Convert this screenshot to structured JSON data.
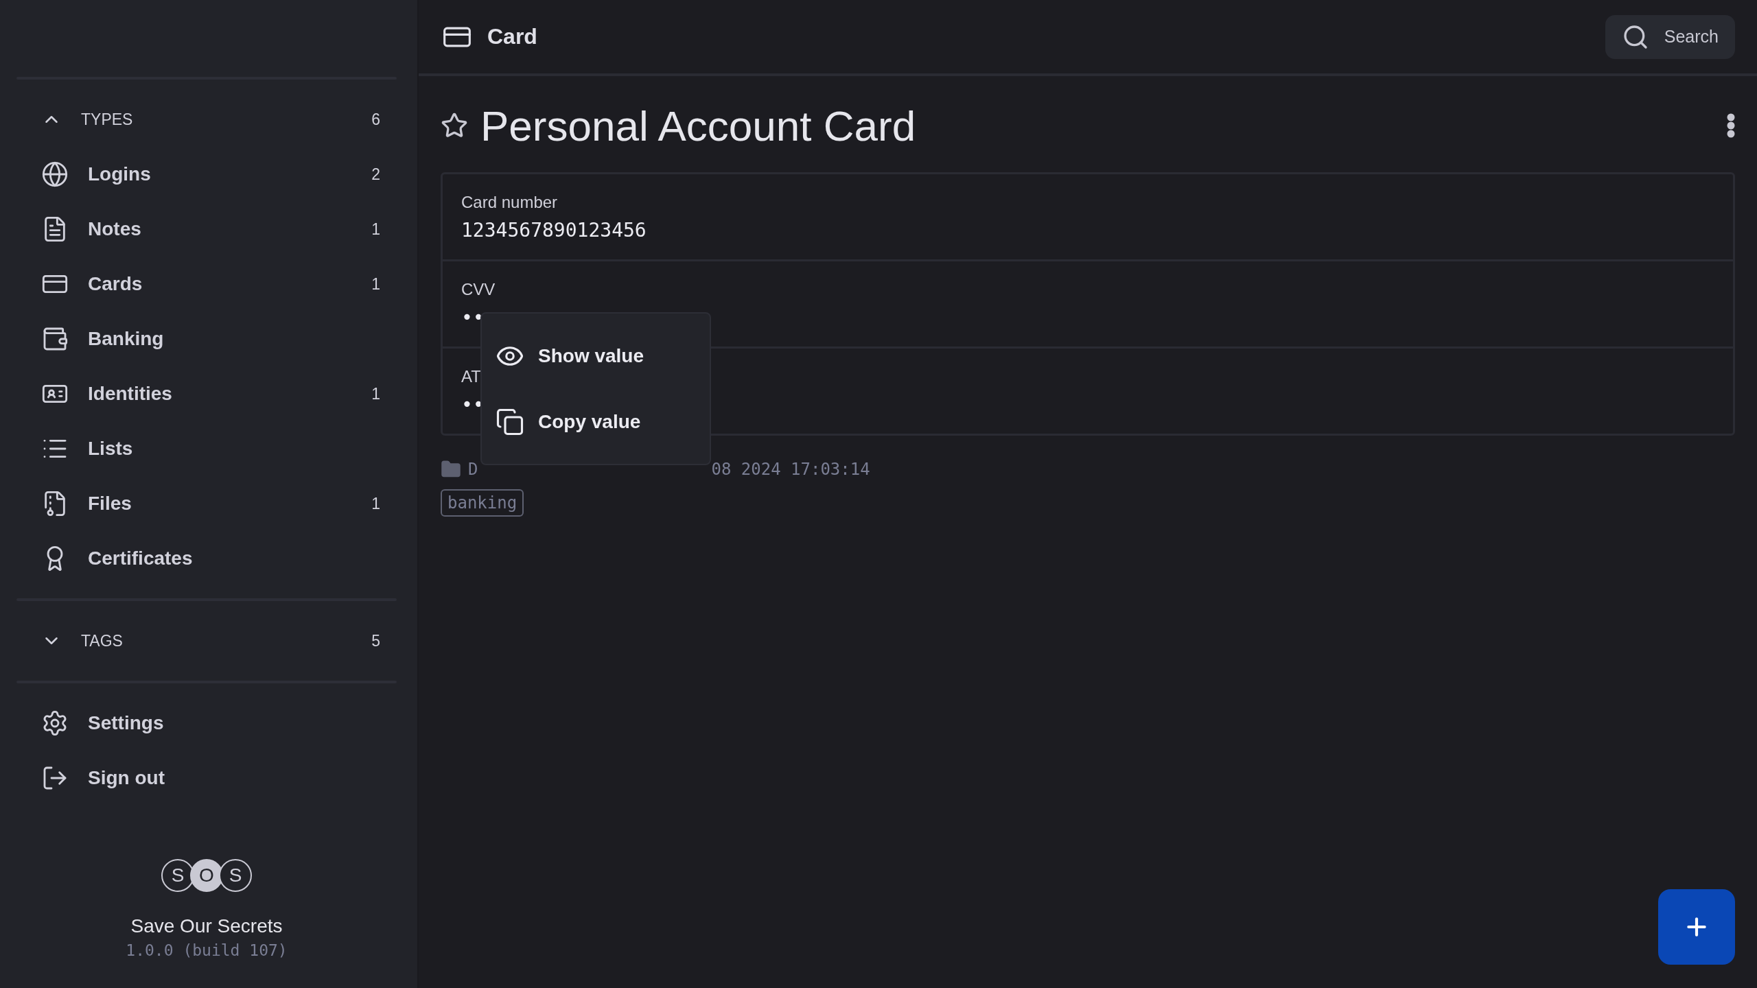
{
  "sidebar": {
    "sections": [
      {
        "label": "TYPES",
        "count": "6",
        "expanded": true,
        "items": [
          {
            "label": "Logins",
            "count": "2"
          },
          {
            "label": "Notes",
            "count": "1"
          },
          {
            "label": "Cards",
            "count": "1"
          },
          {
            "label": "Banking"
          },
          {
            "label": "Identities",
            "count": "1"
          },
          {
            "label": "Lists"
          },
          {
            "label": "Files",
            "count": "1"
          },
          {
            "label": "Certificates"
          }
        ]
      },
      {
        "label": "TAGS",
        "count": "5",
        "expanded": false
      }
    ],
    "actions": [
      {
        "label": "Settings"
      },
      {
        "label": "Sign out"
      }
    ],
    "logo": [
      "S",
      "O",
      "S"
    ],
    "app_name": "Save Our Secrets",
    "version": "1.0.0 (build 107)"
  },
  "header": {
    "title": "Card",
    "search": "Search"
  },
  "item": {
    "title": "Personal Account Card",
    "favorite": false,
    "fields": [
      {
        "label": "Card number",
        "value": "1234567890123456"
      },
      {
        "label": "CVV",
        "value": "••"
      },
      {
        "label": "AT",
        "value": "••"
      }
    ],
    "meta": {
      "folder": "D",
      "date": "08 2024 17:03:14"
    },
    "tags": [
      "banking"
    ]
  },
  "context_menu": {
    "items": [
      {
        "label": "Show value"
      },
      {
        "label": "Copy value"
      }
    ]
  }
}
